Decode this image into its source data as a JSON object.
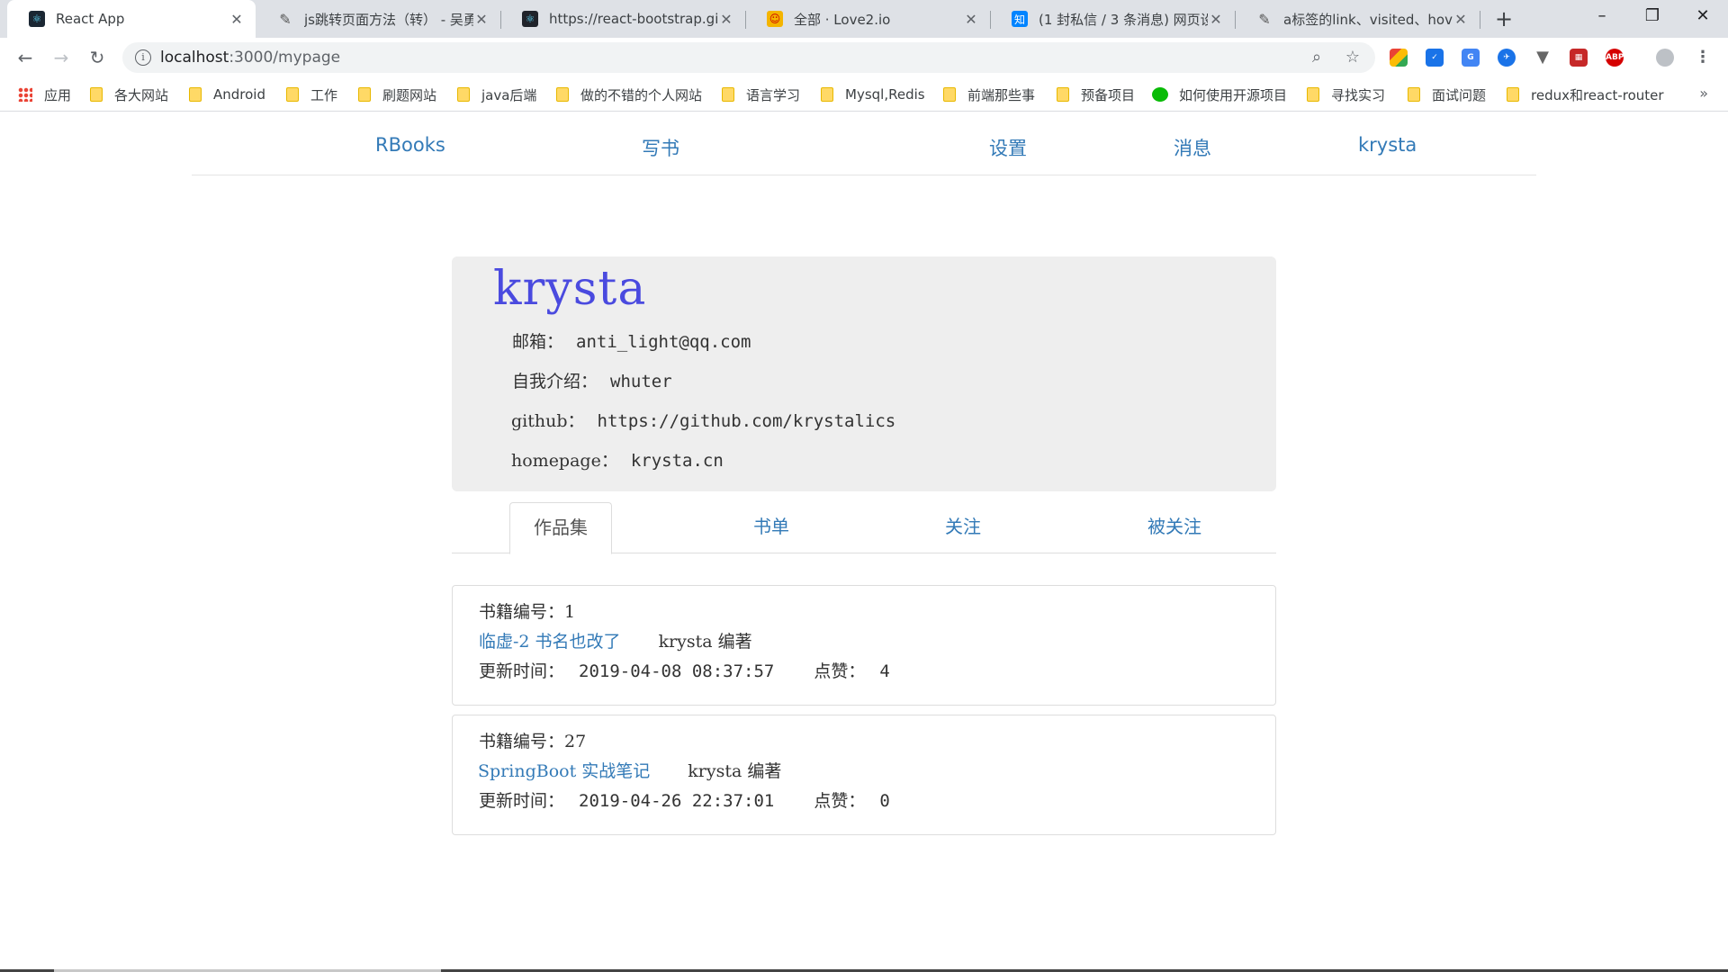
{
  "browser": {
    "tabs": [
      {
        "title": "React App",
        "favicon": "react-icon",
        "color": "#1b2733"
      },
      {
        "title": "js跳转页面方法（转） - 吴勇",
        "favicon": "feather-icon",
        "color": "#555555"
      },
      {
        "title": "https://react-bootstrap.git",
        "favicon": "react-icon",
        "color": "#20232a"
      },
      {
        "title": "全部 · Love2.io",
        "favicon": "smiley-icon",
        "color": "#f4b400"
      },
      {
        "title": "(1 封私信 / 3 条消息) 网页设",
        "favicon": "zhihu-icon",
        "color": "#0084ff"
      },
      {
        "title": "a标签的link、visited、hove",
        "favicon": "feather-icon",
        "color": "#555555"
      }
    ],
    "url_host": "localhost",
    "url_path": ":3000/mypage",
    "bookmarks": [
      "应用",
      "各大网站",
      "Android",
      "工作",
      "刷题网站",
      "java后端",
      "做的不错的个人网站",
      "语言学习",
      "Mysql,Redis",
      "前端那些事",
      "预备项目",
      "如何使用开源项目",
      "寻找实习",
      "面试问题",
      "redux和react-router"
    ]
  },
  "nav": {
    "brand": "RBooks",
    "write": "写书",
    "settings": "设置",
    "messages": "消息",
    "user": "krysta"
  },
  "profile": {
    "name": "krysta",
    "email_label": "邮箱：",
    "email": "anti_light@qq.com",
    "intro_label": "自我介绍：",
    "intro": "whuter",
    "github_label": "github：",
    "github": "https://github.com/krystalics",
    "homepage_label": "homepage：",
    "homepage": "krysta.cn"
  },
  "tabs": [
    "作品集",
    "书单",
    "关注",
    "被关注"
  ],
  "books": [
    {
      "id_label": "书籍编号：",
      "id": "1",
      "title": "临虚-2 书名也改了",
      "author": "krysta 编著",
      "updated_label": "更新时间：",
      "updated": "2019-04-08 08:37:57",
      "likes_label": "点赞：",
      "likes": "4"
    },
    {
      "id_label": "书籍编号：",
      "id": "27",
      "title": "SpringBoot 实战笔记",
      "author": "krysta 编著",
      "updated_label": "更新时间：",
      "updated": "2019-04-26 22:37:01",
      "likes_label": "点赞：",
      "likes": "0"
    }
  ]
}
